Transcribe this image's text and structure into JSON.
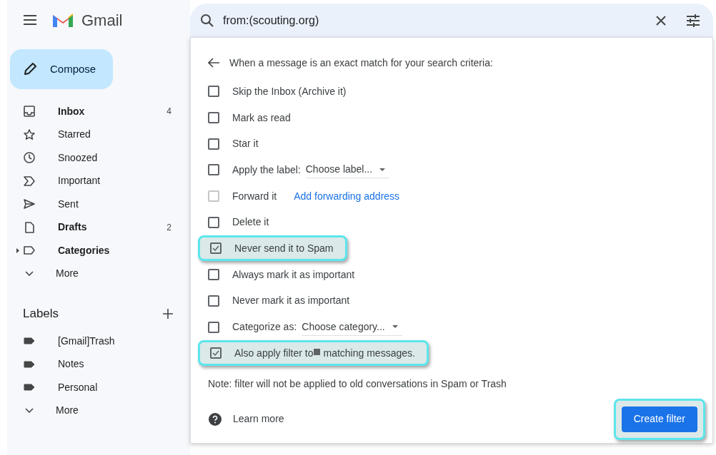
{
  "app": {
    "name": "Gmail"
  },
  "compose": {
    "label": "Compose"
  },
  "sidebar": {
    "items": [
      {
        "kind": "inbox",
        "label": "Inbox",
        "bold": true,
        "count": "4"
      },
      {
        "kind": "star",
        "label": "Starred",
        "bold": false
      },
      {
        "kind": "clock",
        "label": "Snoozed",
        "bold": false
      },
      {
        "kind": "important",
        "label": "Important",
        "bold": false
      },
      {
        "kind": "send",
        "label": "Sent",
        "bold": false
      },
      {
        "kind": "draft",
        "label": "Drafts",
        "bold": true,
        "count": "2"
      },
      {
        "kind": "label",
        "label": "Categories",
        "bold": true,
        "expandable": true
      },
      {
        "kind": "chevron",
        "label": "More",
        "bold": false
      }
    ]
  },
  "labels": {
    "title": "Labels",
    "items": [
      {
        "kind": "tag",
        "label": "[Gmail]Trash"
      },
      {
        "kind": "tag",
        "label": "Notes"
      },
      {
        "kind": "tag",
        "label": "Personal"
      },
      {
        "kind": "chevron",
        "label": "More"
      }
    ]
  },
  "search": {
    "value": "from:(scouting.org)"
  },
  "filter_dialog": {
    "heading": "When a message is an exact match for your search criteria:",
    "options": [
      {
        "kind": "checkbox",
        "label": "Skip the Inbox (Archive it)",
        "checked": false,
        "disabled": false,
        "highlighted": false
      },
      {
        "kind": "checkbox",
        "label": "Mark as read",
        "checked": false,
        "disabled": false,
        "highlighted": false
      },
      {
        "kind": "checkbox",
        "label": "Star it",
        "checked": false,
        "disabled": false,
        "highlighted": false
      },
      {
        "kind": "select",
        "label": "Apply the label:",
        "select": "Choose label...",
        "checked": false,
        "disabled": false,
        "highlighted": false
      },
      {
        "kind": "link",
        "label": "Forward it",
        "link": "Add forwarding address",
        "checked": false,
        "disabled": true,
        "highlighted": false
      },
      {
        "kind": "checkbox",
        "label": "Delete it",
        "checked": false,
        "disabled": false,
        "highlighted": false
      },
      {
        "kind": "checkbox",
        "label": "Never send it to Spam",
        "checked": true,
        "disabled": false,
        "highlighted": true
      },
      {
        "kind": "checkbox",
        "label": "Always mark it as important",
        "checked": false,
        "disabled": false,
        "highlighted": false
      },
      {
        "kind": "checkbox",
        "label": "Never mark it as important",
        "checked": false,
        "disabled": false,
        "highlighted": false
      },
      {
        "kind": "select",
        "label": "Categorize as:",
        "select": "Choose category...",
        "checked": false,
        "disabled": false,
        "highlighted": false
      },
      {
        "kind": "redacted",
        "label": "Also apply filter to",
        "label_after": "matching messages.",
        "checked": true,
        "disabled": false,
        "highlighted": true
      }
    ],
    "note": "Note: filter will not be applied to old conversations in Spam or Trash",
    "learn_more": "Learn more",
    "create_button": {
      "label": "Create filter",
      "highlighted": true
    }
  }
}
